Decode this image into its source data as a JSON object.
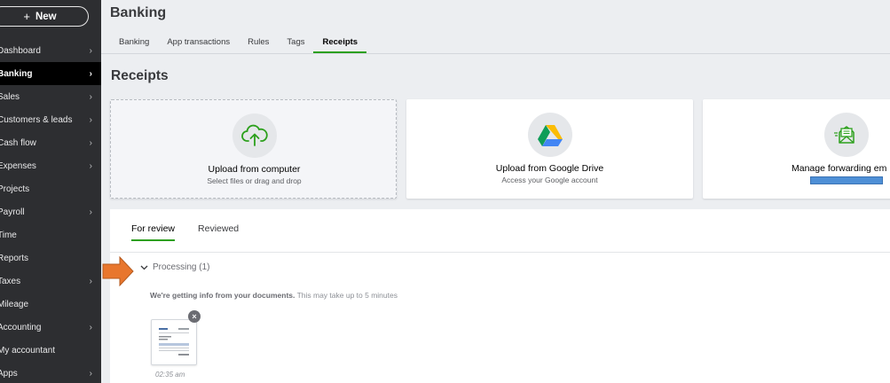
{
  "sidebar": {
    "new_label": "New",
    "items": [
      {
        "label": "Dashboard",
        "chevron": true,
        "active": false
      },
      {
        "label": "Banking",
        "chevron": true,
        "active": true
      },
      {
        "label": "Sales",
        "chevron": true,
        "active": false
      },
      {
        "label": "Customers & leads",
        "chevron": true,
        "active": false
      },
      {
        "label": "Cash flow",
        "chevron": true,
        "active": false
      },
      {
        "label": "Expenses",
        "chevron": true,
        "active": false
      },
      {
        "label": "Projects",
        "chevron": false,
        "active": false
      },
      {
        "label": "Payroll",
        "chevron": true,
        "active": false
      },
      {
        "label": "Time",
        "chevron": false,
        "active": false
      },
      {
        "label": "Reports",
        "chevron": false,
        "active": false
      },
      {
        "label": "Taxes",
        "chevron": true,
        "active": false
      },
      {
        "label": "Mileage",
        "chevron": false,
        "active": false
      },
      {
        "label": "Accounting",
        "chevron": true,
        "active": false
      },
      {
        "label": "My accountant",
        "chevron": false,
        "active": false
      },
      {
        "label": "Apps",
        "chevron": true,
        "active": false
      }
    ]
  },
  "header": {
    "title": "Banking",
    "tabs": [
      "Banking",
      "App transactions",
      "Rules",
      "Tags",
      "Receipts"
    ],
    "active_tab": "Receipts"
  },
  "receipts": {
    "title": "Receipts",
    "cards": [
      {
        "title": "Upload from computer",
        "subtitle": "Select files or drag and drop",
        "icon": "cloud-upload-icon"
      },
      {
        "title": "Upload from Google Drive",
        "subtitle": "Access your Google account",
        "icon": "google-drive-icon"
      },
      {
        "title": "Manage forwarding em",
        "subtitle": "",
        "icon": "email-forward-icon"
      }
    ]
  },
  "review": {
    "tabs": [
      "For review",
      "Reviewed"
    ],
    "active_tab": "For review",
    "processing_label": "Processing (1)",
    "info_bold": "We're getting info from your documents.",
    "info_rest": " This may take up to 5 minutes",
    "thumb_time": "02:35 am"
  },
  "colors": {
    "accent": "#2ca01c",
    "sidebar_bg": "#2d2e31",
    "annotation_arrow": "#e8762d"
  }
}
